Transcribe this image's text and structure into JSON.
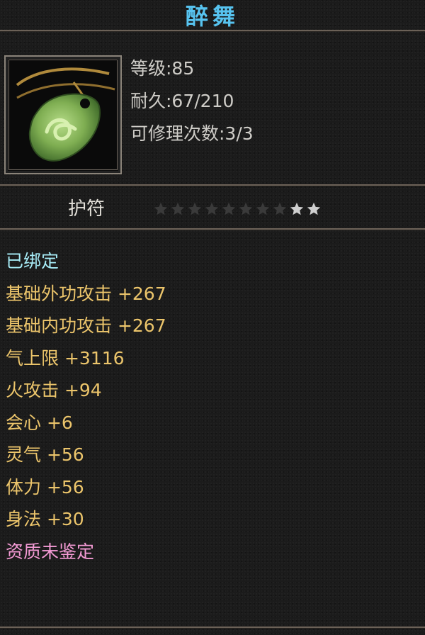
{
  "item": {
    "name": "醉舞",
    "level": "等级:85",
    "durability": "耐久:67/210",
    "repair_times": "可修理次数:3/3",
    "type": "护符",
    "stars_total": 10,
    "stars_lit": 2,
    "bound_status": "已绑定",
    "attributes": [
      "基础外功攻击 +267",
      "基础内功攻击 +267",
      "气上限 +3116",
      "火攻击 +94",
      "会心 +6",
      "灵气 +56",
      "体力 +56",
      "身法 +30"
    ],
    "quality_status": "资质未鉴定"
  },
  "colors": {
    "title": "#57c3ef",
    "bound": "#a7ecf7",
    "attribute": "#ecc56b",
    "quality": "#f49bd5",
    "star_lit": "#cfcfcf",
    "star_dim": "#3a3a3a"
  },
  "icons": {
    "item_icon": "jade-amulet-icon",
    "star": "star-icon"
  }
}
